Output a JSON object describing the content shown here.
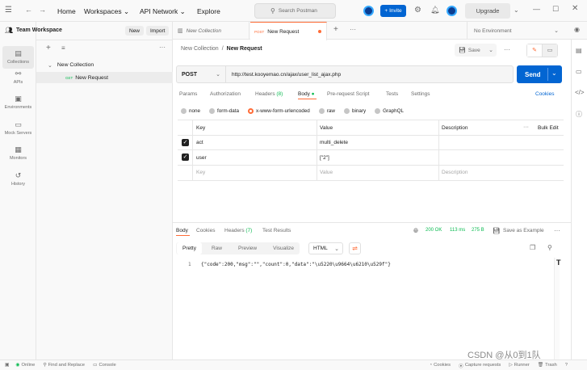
{
  "titlebar": {
    "home": "Home",
    "workspaces": "Workspaces",
    "api_network": "API Network",
    "explore": "Explore",
    "search_placeholder": "Search Postman",
    "invite": "Invite",
    "upgrade": "Upgrade"
  },
  "rail": {
    "items": [
      "Collections",
      "APIs",
      "Environments",
      "Mock Servers",
      "Monitors",
      "History"
    ]
  },
  "sidebar": {
    "workspace": "Team Workspace",
    "new_btn": "New",
    "import_btn": "Import",
    "collection": "New Collection",
    "request_method": "GET",
    "request_name": "New Request"
  },
  "tabs": {
    "tab1": "New Collection",
    "tab2_method": "POST",
    "tab2_name": "New Request",
    "environment": "No Environment"
  },
  "breadcrumb": {
    "collection": "New Collection",
    "separator": "/",
    "request": "New Request",
    "save": "Save"
  },
  "request": {
    "method": "POST",
    "url": "http://test.kooyemao.cn/ajax/user_list_ajax.php",
    "send": "Send",
    "tabs": [
      "Params",
      "Authorization",
      "Headers",
      "Body",
      "Pre-request Script",
      "Tests",
      "Settings"
    ],
    "headers_count": "(8)",
    "cookies": "Cookies",
    "body_types": [
      "none",
      "form-data",
      "x-www-form-urlencoded",
      "raw",
      "binary",
      "GraphQL"
    ]
  },
  "params_table": {
    "col_key": "Key",
    "col_value": "Value",
    "col_description": "Description",
    "bulk_edit": "Bulk Edit",
    "rows": [
      {
        "key": "act",
        "value": "multi_delete"
      },
      {
        "key": "user",
        "value": "[\"2\"]"
      }
    ],
    "placeholder_key": "Key",
    "placeholder_value": "Value",
    "placeholder_description": "Description"
  },
  "response": {
    "tabs": [
      "Body",
      "Cookies",
      "Headers",
      "Test Results"
    ],
    "headers_count": "(7)",
    "status": "200 OK",
    "time": "113 ms",
    "size": "275 B",
    "save_example": "Save as Example",
    "view_tabs": [
      "Pretty",
      "Raw",
      "Preview",
      "Visualize"
    ],
    "format": "HTML",
    "line_number": "1",
    "code_line": "{\"code\":200,\"msg\":\"\",\"count\":0,\"data\":\"\\u5220\\u9664\\u6210\\u529f\"}"
  },
  "statusbar": {
    "online": "Online",
    "find_replace": "Find and Replace",
    "console": "Console",
    "cookies": "Cookies",
    "capture": "Capture requests",
    "runner": "Runner",
    "trash": "Trash",
    "watermark": "CSDN @从0到1队"
  }
}
